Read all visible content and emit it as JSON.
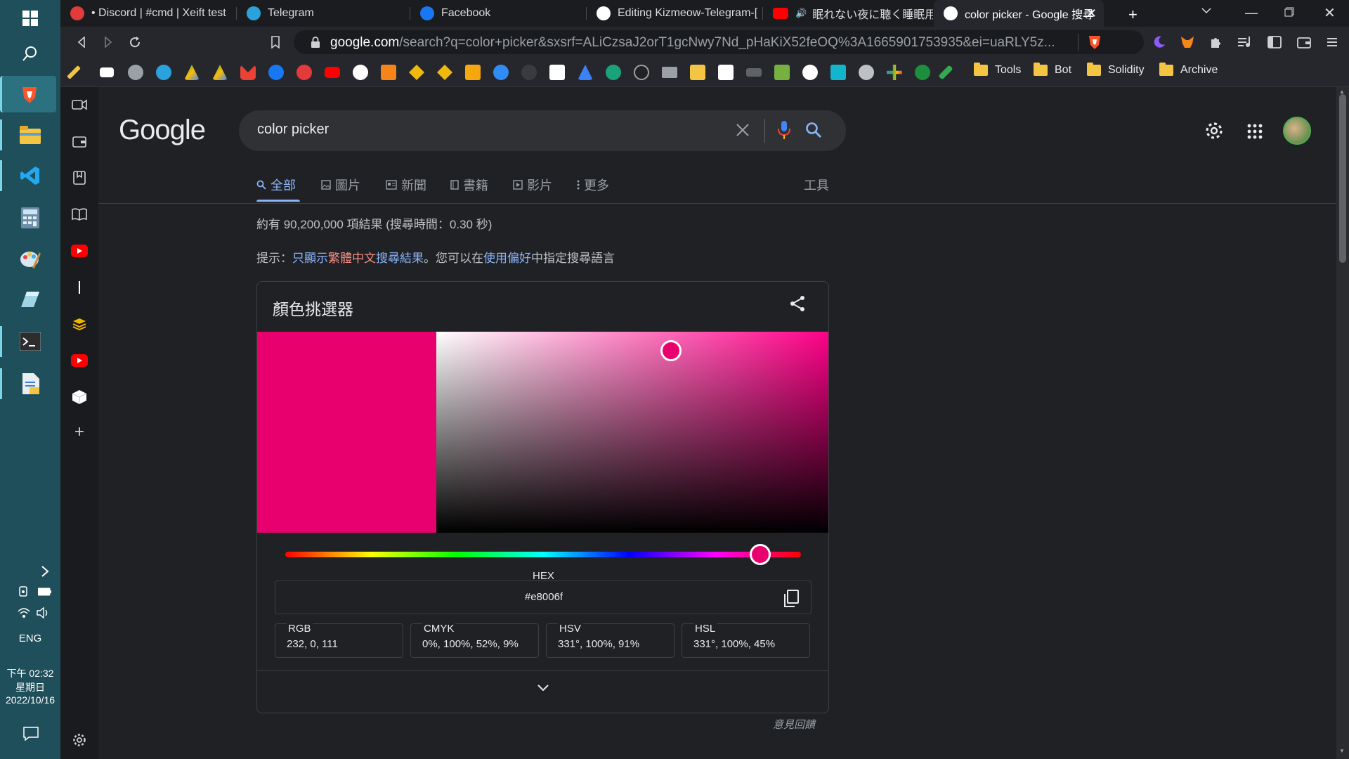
{
  "taskbar": {
    "lang": "ENG",
    "time": "下午 02:32",
    "weekday": "星期日",
    "date": "2022/10/16"
  },
  "tabs": [
    {
      "title": "• Discord | #cmd | Xeift test"
    },
    {
      "title": "Telegram"
    },
    {
      "title": "Facebook"
    },
    {
      "title": "Editing Kizmeow-Telegram-["
    },
    {
      "title": "眠れない夜に聴く睡眠用BGM"
    },
    {
      "title": "color picker - Google 搜尋",
      "active": true
    }
  ],
  "toolbar": {
    "url_host": "google.com",
    "url_rest": "/search?q=color+picker&sxsrf=ALiCzsaJ2orT1gcNwy7Nd_pHaKiX52feOQ%3A1665901753935&ei=uaRLY5z..."
  },
  "bookmarks": {
    "folders": [
      "Tools",
      "Bot",
      "Solidity",
      "Archive"
    ]
  },
  "google": {
    "logo": "Google",
    "search_value": "color picker",
    "nav_tabs": [
      "全部",
      "圖片",
      "新聞",
      "書籍",
      "影片",
      "更多"
    ],
    "tools": "工具",
    "result_stats": "約有 90,200,000 項結果 (搜尋時間：0.30 秒)",
    "hint_prefix": "提示：",
    "hint_link_a": "只顯示",
    "hint_link_red": "繁體中文",
    "hint_link_b": "搜尋結果",
    "hint_mid": "。您可以在",
    "hint_link_pref": "使用偏好",
    "hint_suffix": "中指定搜尋語言",
    "feedback": "意見回饋"
  },
  "picker": {
    "title": "顏色挑選器",
    "hex_label": "HEX",
    "hex_value": "#e8006f",
    "color": "#e8006f",
    "rgb_label": "RGB",
    "rgb_value": "232, 0, 111",
    "cmyk_label": "CMYK",
    "cmyk_value": "0%, 100%, 52%, 9%",
    "hsv_label": "HSV",
    "hsv_value": "331°, 100%, 91%",
    "hsl_label": "HSL",
    "hsl_value": "331°, 100%, 45%"
  },
  "colors": {
    "accent": "#8ab4f8",
    "taskbar": "#1f4f5a"
  }
}
